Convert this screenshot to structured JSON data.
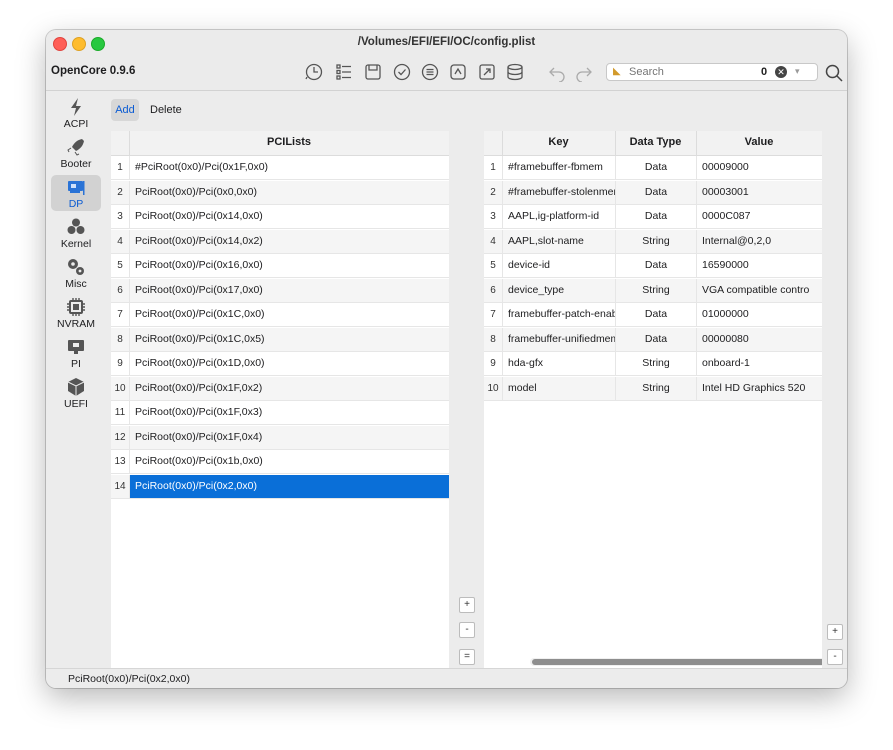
{
  "window": {
    "title": "/Volumes/EFI/EFI/OC/config.plist"
  },
  "toolbar": {
    "app_name": "OpenCore 0.9.6",
    "icons": [
      "history-icon",
      "list-icon",
      "save-icon",
      "checkmark-icon",
      "menu-list-icon",
      "pcie-icon",
      "share-icon",
      "database-icon",
      "undo-icon",
      "redo-icon"
    ],
    "search": {
      "placeholder": "Search",
      "count": "0"
    }
  },
  "sidebar": {
    "items": [
      {
        "label": "ACPI",
        "icon": "bolt-icon"
      },
      {
        "label": "Booter",
        "icon": "rocket-icon"
      },
      {
        "label": "DP",
        "icon": "gpu-card-icon",
        "selected": true
      },
      {
        "label": "Kernel",
        "icon": "kernel-icon"
      },
      {
        "label": "Misc",
        "icon": "gears-icon"
      },
      {
        "label": "NVRAM",
        "icon": "chip-icon"
      },
      {
        "label": "PI",
        "icon": "monitor-icon"
      },
      {
        "label": "UEFI",
        "icon": "cube-icon"
      }
    ]
  },
  "actions": {
    "add": "Add",
    "delete": "Delete"
  },
  "left_table": {
    "header": "PCILists",
    "rows": [
      "#PciRoot(0x0)/Pci(0x1F,0x0)",
      "PciRoot(0x0)/Pci(0x0,0x0)",
      "PciRoot(0x0)/Pci(0x14,0x0)",
      "PciRoot(0x0)/Pci(0x14,0x2)",
      "PciRoot(0x0)/Pci(0x16,0x0)",
      "PciRoot(0x0)/Pci(0x17,0x0)",
      "PciRoot(0x0)/Pci(0x1C,0x0)",
      "PciRoot(0x0)/Pci(0x1C,0x5)",
      "PciRoot(0x0)/Pci(0x1D,0x0)",
      "PciRoot(0x0)/Pci(0x1F,0x2)",
      "PciRoot(0x0)/Pci(0x1F,0x3)",
      "PciRoot(0x0)/Pci(0x1F,0x4)",
      "PciRoot(0x0)/Pci(0x1b,0x0)",
      "PciRoot(0x0)/Pci(0x2,0x0)"
    ],
    "selected_index": 13
  },
  "right_table": {
    "headers": {
      "key": "Key",
      "type": "Data Type",
      "value": "Value"
    },
    "rows": [
      {
        "key": "#framebuffer-fbmem",
        "type": "Data",
        "value": "00009000"
      },
      {
        "key": "#framebuffer-stolenmem",
        "type": "Data",
        "value": "00003001"
      },
      {
        "key": "AAPL,ig-platform-id",
        "type": "Data",
        "value": "0000C087"
      },
      {
        "key": "AAPL,slot-name",
        "type": "String",
        "value": "Internal@0,2,0"
      },
      {
        "key": "device-id",
        "type": "Data",
        "value": "16590000"
      },
      {
        "key": "device_type",
        "type": "String",
        "value": "VGA compatible contro"
      },
      {
        "key": "framebuffer-patch-enable",
        "type": "Data",
        "value": "01000000"
      },
      {
        "key": "framebuffer-unifiedmem",
        "type": "Data",
        "value": "00000080"
      },
      {
        "key": "hda-gfx",
        "type": "String",
        "value": "onboard-1"
      },
      {
        "key": "model",
        "type": "String",
        "value": "Intel HD Graphics 520"
      }
    ]
  },
  "buttons": {
    "plus": "+",
    "minus": "-",
    "equals": "="
  },
  "status": {
    "text": "PciRoot(0x0)/Pci(0x2,0x0)"
  },
  "colors": {
    "accent": "#0a6fd8",
    "selected_label": "#0a5bd3"
  }
}
